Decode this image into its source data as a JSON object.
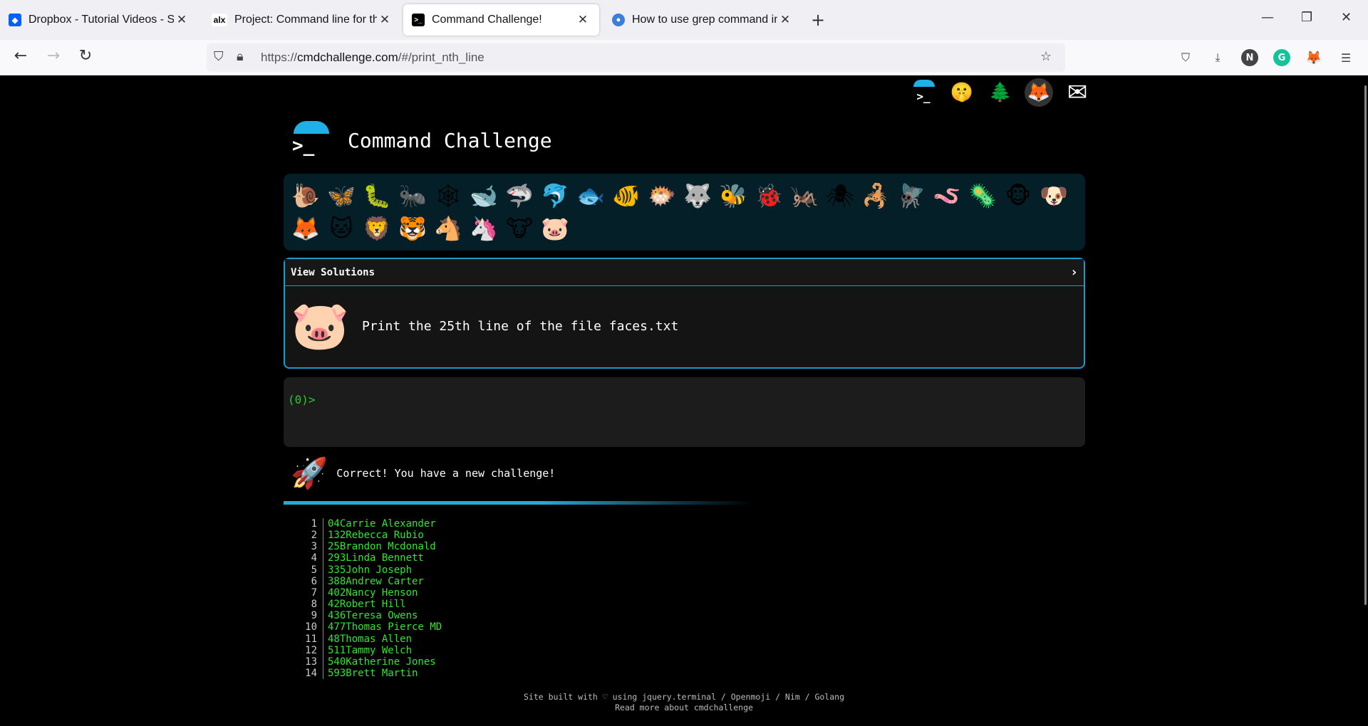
{
  "browser": {
    "tabs": [
      {
        "title": "Dropbox - Tutorial Videos - Sim",
        "favicon": "dropbox-icon",
        "active": false
      },
      {
        "title": "Project: Command line for the w",
        "favicon": "alx-icon",
        "active": false
      },
      {
        "title": "Command Challenge!",
        "favicon": "terminal-icon",
        "active": true
      },
      {
        "title": "How to use grep command in U",
        "favicon": "globe-icon",
        "active": false
      }
    ],
    "url_scheme": "https://",
    "url_host": "cmdchallenge.com",
    "url_path": "/#/print_nth_line",
    "profile_initial": "N",
    "grammarly_initial": "G"
  },
  "site": {
    "title": "Command Challenge",
    "header_icons": [
      "terminal-logo-icon",
      "shushing-face-icon",
      "tree-icon",
      "gitlab-icon",
      "envelope-icon"
    ],
    "animals": [
      "🐌",
      "🦋",
      "🐛",
      "🐜",
      "🕸",
      "🐋",
      "🦈",
      "🐬",
      "🐟",
      "🐠",
      "🐡",
      "🐺",
      "🐝",
      "🐞",
      "🦗",
      "🕷",
      "🦂",
      "🪰",
      "🪱",
      "🦠",
      "🐵",
      "🐶",
      "🦊",
      "🐱",
      "🦁",
      "🐯",
      "🐴",
      "🦄",
      "🐮",
      "🐷"
    ],
    "view_solutions": "View Solutions",
    "challenge_text": "Print the 25th line of the file faces.txt",
    "prompt": "(0)>",
    "result_message": "Correct! You have a new challenge!",
    "output_lines": [
      {
        "n": "1",
        "text": "04Carrie Alexander"
      },
      {
        "n": "2",
        "text": "132Rebecca Rubio"
      },
      {
        "n": "3",
        "text": "25Brandon Mcdonald"
      },
      {
        "n": "4",
        "text": "293Linda Bennett"
      },
      {
        "n": "5",
        "text": "335John Joseph"
      },
      {
        "n": "6",
        "text": "388Andrew Carter"
      },
      {
        "n": "7",
        "text": "402Nancy Henson"
      },
      {
        "n": "8",
        "text": "42Robert Hill"
      },
      {
        "n": "9",
        "text": "436Teresa Owens"
      },
      {
        "n": "10",
        "text": "477Thomas Pierce MD"
      },
      {
        "n": "11",
        "text": "48Thomas Allen"
      },
      {
        "n": "12",
        "text": "511Tammy Welch"
      },
      {
        "n": "13",
        "text": "540Katherine Jones"
      },
      {
        "n": "14",
        "text": "593Brett Martin"
      }
    ],
    "footer_line1": "Site built with ♡ using jquery.terminal / Openmoji / Nim / Golang",
    "footer_line2": "Read more about cmdchallenge"
  },
  "colors": {
    "accent": "#1fb0e8",
    "terminal_green": "#2ee62e",
    "panel_bg": "#051f28"
  }
}
